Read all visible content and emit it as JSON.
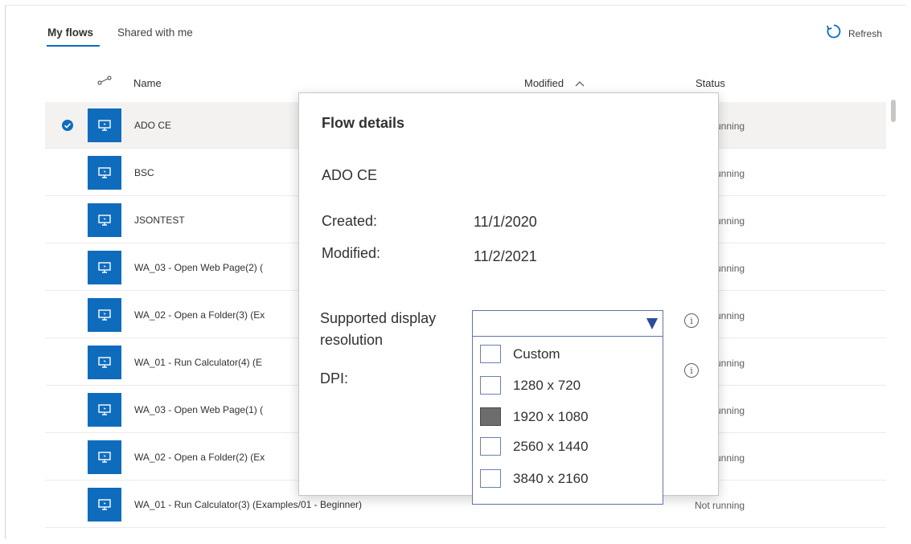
{
  "tabs": {
    "my_flows": "My flows",
    "shared": "Shared with me"
  },
  "refresh_label": "Refresh",
  "table": {
    "headers": {
      "name": "Name",
      "modified": "Modified",
      "status": "Status"
    },
    "rows": [
      {
        "name": "ADO CE",
        "status": "Not running"
      },
      {
        "name": "BSC",
        "status": "Not running"
      },
      {
        "name": "JSONTEST",
        "status": "Not running"
      },
      {
        "name": "WA_03 - Open Web Page(2) (",
        "status": "Not running"
      },
      {
        "name": "WA_02 - Open a Folder(3) (Ex",
        "status": "Not running"
      },
      {
        "name": "WA_01 - Run Calculator(4) (E",
        "status": "Not running"
      },
      {
        "name": "WA_03 - Open Web Page(1) (",
        "status": "Not running"
      },
      {
        "name": "WA_02 - Open a Folder(2) (Ex",
        "status": "Not running"
      },
      {
        "name": "WA_01 - Run Calculator(3) (Examples/01 - Beginner)",
        "status": "Not running"
      }
    ]
  },
  "dialog": {
    "title": "Flow details",
    "flow_name": "ADO CE",
    "created_label": "Created:",
    "created_value": "11/1/2020",
    "modified_label": "Modified:",
    "modified_value": "11/2/2021",
    "resolution_label_1": "Supported display",
    "resolution_label_2": "resolution",
    "dpi_label": "DPI:",
    "resolution_select_value": "",
    "options": [
      "Custom",
      "1280 x 720",
      "1920 x 1080",
      "2560 x 1440",
      "3840 x 2160"
    ],
    "checked_option": "1920 x 1080"
  },
  "colors": {
    "accent": "#0f6cbd",
    "dropdown_border": "#6274a8",
    "checked_box": "#6d6d6d"
  }
}
